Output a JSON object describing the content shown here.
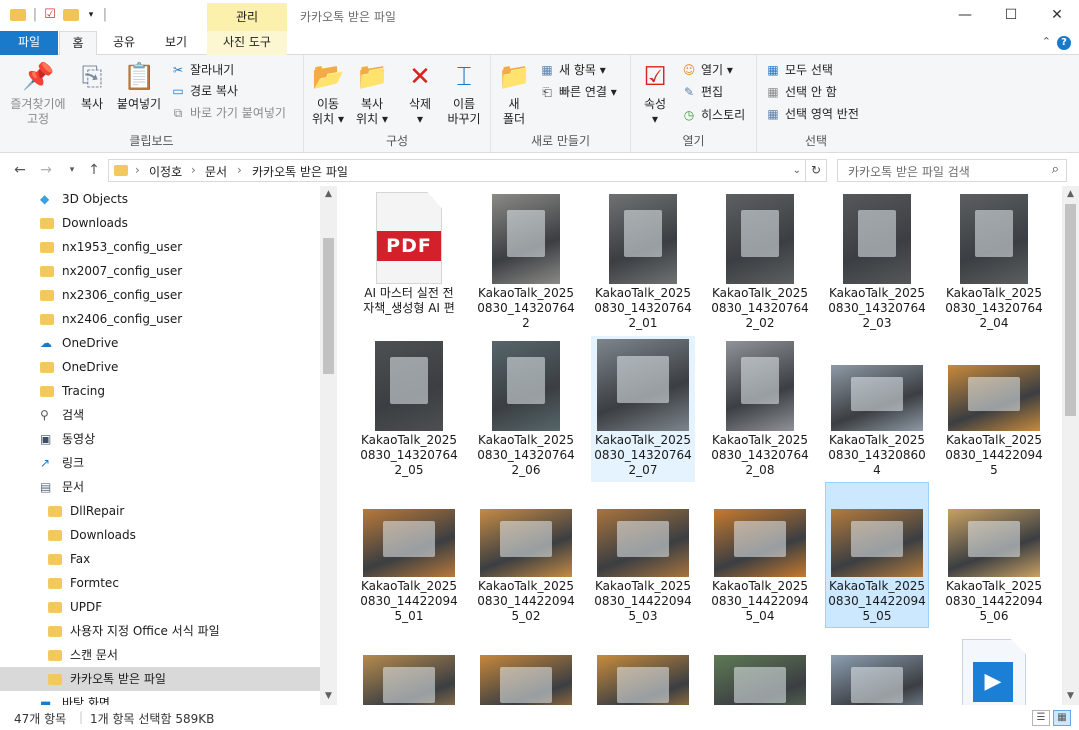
{
  "titlebar": {
    "context_tab": "관리",
    "title": "카카오톡 받은 파일",
    "minimize": "—",
    "maximize": "☐",
    "close": "✕"
  },
  "ribbon_tabs": {
    "file": "파일",
    "home": "홈",
    "share": "공유",
    "view": "보기",
    "picture_tools": "사진 도구",
    "help": "?"
  },
  "ribbon": {
    "clipboard": {
      "label": "클립보드",
      "pin_line1": "즐겨찾기에",
      "pin_line2": "고정",
      "copy": "복사",
      "paste": "붙여넣기",
      "cut": "잘라내기",
      "copy_path": "경로 복사",
      "paste_shortcut": "바로 가기 붙여넣기"
    },
    "organize": {
      "label": "구성",
      "move_line1": "이동",
      "move_line2": "위치",
      "copy_line1": "복사",
      "copy_line2": "위치",
      "delete": "삭제",
      "rename_line1": "이름",
      "rename_line2": "바꾸기"
    },
    "new": {
      "label": "새로 만들기",
      "folder_line1": "새",
      "folder_line2": "폴더",
      "new_item": "새 항목",
      "easy_access": "빠른 연결"
    },
    "open": {
      "label": "열기",
      "properties": "속성",
      "open": "열기",
      "edit": "편집",
      "history": "히스토리"
    },
    "select": {
      "label": "선택",
      "select_all": "모두 선택",
      "select_none": "선택 안 함",
      "invert": "선택 영역 반전"
    }
  },
  "address": {
    "crumbs": [
      "이정호",
      "문서",
      "카카오톡 받은 파일"
    ],
    "search_placeholder": "카카오톡 받은 파일 검색"
  },
  "nav": {
    "items": [
      {
        "label": "3D Objects",
        "icon": "3d-objects-icon"
      },
      {
        "label": "Downloads",
        "icon": "folder-icon"
      },
      {
        "label": "nx1953_config_user",
        "icon": "folder-icon"
      },
      {
        "label": "nx2007_config_user",
        "icon": "folder-icon"
      },
      {
        "label": "nx2306_config_user",
        "icon": "folder-icon"
      },
      {
        "label": "nx2406_config_user",
        "icon": "folder-icon"
      },
      {
        "label": "OneDrive",
        "icon": "cloud-icon"
      },
      {
        "label": "OneDrive",
        "icon": "folder-icon"
      },
      {
        "label": "Tracing",
        "icon": "folder-icon"
      },
      {
        "label": "검색",
        "icon": "search-icon"
      },
      {
        "label": "동영상",
        "icon": "video-icon"
      },
      {
        "label": "링크",
        "icon": "link-icon"
      },
      {
        "label": "문서",
        "icon": "document-icon"
      },
      {
        "label": "DllRepair",
        "icon": "folder-icon"
      },
      {
        "label": "Downloads",
        "icon": "folder-icon"
      },
      {
        "label": "Fax",
        "icon": "folder-icon"
      },
      {
        "label": "Formtec",
        "icon": "folder-icon"
      },
      {
        "label": "UPDF",
        "icon": "folder-icon"
      },
      {
        "label": "사용자 지정 Office 서식 파일",
        "icon": "folder-icon"
      },
      {
        "label": "스캔 문서",
        "icon": "folder-icon"
      },
      {
        "label": "카카오톡 받은 파일",
        "icon": "folder-icon",
        "selected": true
      },
      {
        "label": "바탕 화면",
        "icon": "desktop-icon"
      }
    ]
  },
  "files": [
    {
      "name": "AI 마스터 실전 전자책_생성형 AI 편",
      "kind": "pdf",
      "pdf_label": "PDF"
    },
    {
      "name": "KakaoTalk_20250830_143207642",
      "kind": "photo",
      "color": "#8a8a86"
    },
    {
      "name": "KakaoTalk_20250830_143207642_01",
      "kind": "photo",
      "color": "#6f7272"
    },
    {
      "name": "KakaoTalk_20250830_143207642_02",
      "kind": "photo",
      "color": "#5d6062"
    },
    {
      "name": "KakaoTalk_20250830_143207642_03",
      "kind": "photo",
      "color": "#55585b"
    },
    {
      "name": "KakaoTalk_20250830_143207642_04",
      "kind": "photo",
      "color": "#5c5f61"
    },
    {
      "name": "KakaoTalk_20250830_143207642_05",
      "kind": "photo",
      "color": "#4d5052"
    },
    {
      "name": "KakaoTalk_20250830_143207642_06",
      "kind": "photo",
      "color": "#56666a"
    },
    {
      "name": "KakaoTalk_20250830_143207642_07",
      "kind": "photo",
      "color": "#7d858c",
      "state": "hover"
    },
    {
      "name": "KakaoTalk_20250830_143207642_08",
      "kind": "photo",
      "color": "#8f9298"
    },
    {
      "name": "KakaoTalk_20250830_143208604",
      "kind": "photo",
      "color": "#8e9aa6"
    },
    {
      "name": "KakaoTalk_20250830_144220945",
      "kind": "photo",
      "color": "#c98a3a"
    },
    {
      "name": "KakaoTalk_20250830_144220945_01",
      "kind": "photo",
      "color": "#b9793a"
    },
    {
      "name": "KakaoTalk_20250830_144220945_02",
      "kind": "photo",
      "color": "#c58b44"
    },
    {
      "name": "KakaoTalk_20250830_144220945_03",
      "kind": "photo",
      "color": "#a8743e"
    },
    {
      "name": "KakaoTalk_20250830_144220945_04",
      "kind": "photo",
      "color": "#c77a2e"
    },
    {
      "name": "KakaoTalk_20250830_144220945_05",
      "kind": "photo",
      "color": "#b47b3d",
      "state": "selected"
    },
    {
      "name": "KakaoTalk_20250830_144220945_06",
      "kind": "photo",
      "color": "#c9a163"
    },
    {
      "name": "",
      "kind": "photo",
      "color": "#b68b4d"
    },
    {
      "name": "",
      "kind": "photo",
      "color": "#c7883b"
    },
    {
      "name": "",
      "kind": "photo",
      "color": "#c88c3c"
    },
    {
      "name": "",
      "kind": "photo",
      "color": "#5f7a55"
    },
    {
      "name": "",
      "kind": "photo",
      "color": "#8d9fb2"
    },
    {
      "name": "",
      "kind": "video"
    }
  ],
  "status": {
    "count": "47개 항목",
    "selection": "1개 항목 선택함 589KB"
  },
  "colors": {
    "accent": "#1979ca",
    "selected_fill": "#cce8ff",
    "hover_fill": "#e5f3ff",
    "folder": "#f3c860"
  }
}
